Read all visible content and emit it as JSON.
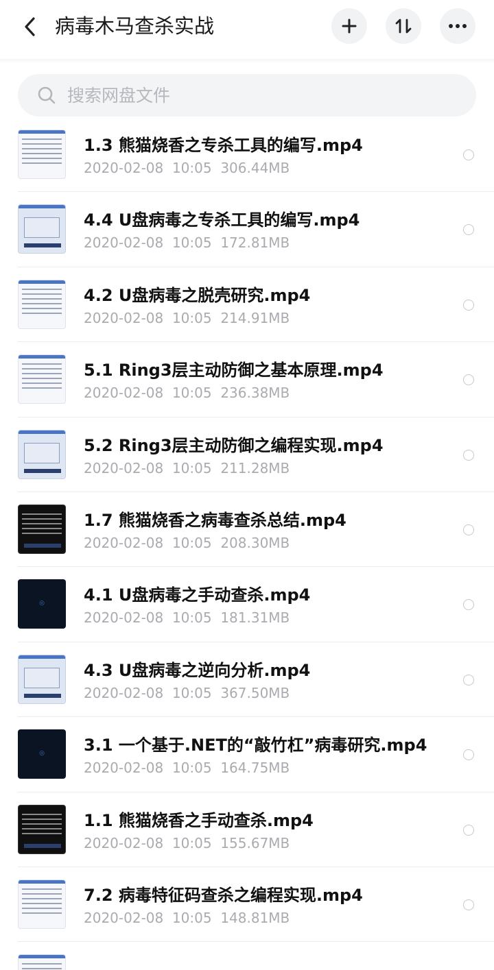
{
  "header": {
    "title": "病毒木马查杀实战",
    "back_icon": "chevron-left-icon",
    "add_icon": "plus-icon",
    "sort_icon": "sort-arrows-icon",
    "more_icon": "more-dots-icon"
  },
  "search": {
    "placeholder": "搜索网盘文件",
    "value": ""
  },
  "files": [
    {
      "name": "1.3 熊猫烧香之专杀工具的编写.mp4",
      "date": "2020-02-08",
      "time": "10:05",
      "size": "306.44MB",
      "thumb": "light"
    },
    {
      "name": "4.4 U盘病毒之专杀工具的编写.mp4",
      "date": "2020-02-08",
      "time": "10:05",
      "size": "172.81MB",
      "thumb": "blue"
    },
    {
      "name": "4.2  U盘病毒之脱壳研究.mp4",
      "date": "2020-02-08",
      "time": "10:05",
      "size": "214.91MB",
      "thumb": "light"
    },
    {
      "name": "5.1 Ring3层主动防御之基本原理.mp4",
      "date": "2020-02-08",
      "time": "10:05",
      "size": "236.38MB",
      "thumb": "light"
    },
    {
      "name": "5.2  Ring3层主动防御之编程实现.mp4",
      "date": "2020-02-08",
      "time": "10:05",
      "size": "211.28MB",
      "thumb": "blue"
    },
    {
      "name": "1.7 熊猫烧香之病毒查杀总结.mp4",
      "date": "2020-02-08",
      "time": "10:05",
      "size": "208.30MB",
      "thumb": "console"
    },
    {
      "name": "4.1 U盘病毒之手动查杀.mp4",
      "date": "2020-02-08",
      "time": "10:05",
      "size": "181.31MB",
      "thumb": "dark"
    },
    {
      "name": "4.3  U盘病毒之逆向分析.mp4",
      "date": "2020-02-08",
      "time": "10:05",
      "size": "367.50MB",
      "thumb": "blue"
    },
    {
      "name": "3.1 一个基于.NET的“敲竹杠”病毒研究.mp4",
      "date": "2020-02-08",
      "time": "10:05",
      "size": "164.75MB",
      "thumb": "dark"
    },
    {
      "name": "1.1 熊猫烧香之手动查杀.mp4",
      "date": "2020-02-08",
      "time": "10:05",
      "size": "155.67MB",
      "thumb": "console"
    },
    {
      "name": "7.2 病毒特征码查杀之编程实现.mp4",
      "date": "2020-02-08",
      "time": "10:05",
      "size": "148.81MB",
      "thumb": "light"
    },
    {
      "name": "",
      "date": "",
      "time": "",
      "size": "",
      "thumb": "light"
    }
  ]
}
